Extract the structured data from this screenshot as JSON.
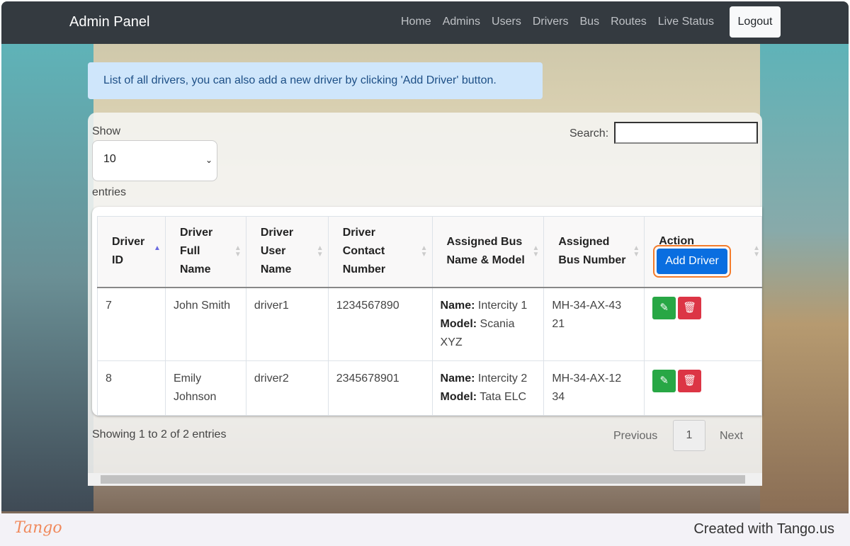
{
  "nav": {
    "brand": "Admin Panel",
    "links": [
      "Home",
      "Admins",
      "Users",
      "Drivers",
      "Bus",
      "Routes",
      "Live Status"
    ],
    "logout": "Logout"
  },
  "alert": "List of all drivers, you can also add a new driver by clicking 'Add Driver' button.",
  "controls": {
    "show": "Show",
    "entries_value": "10",
    "entries": "entries",
    "search_label": "Search:",
    "search_value": ""
  },
  "table": {
    "headers": [
      "Driver ID",
      "Driver Full Name",
      "Driver User Name",
      "Driver Contact Number",
      "Assigned Bus Name & Model",
      "Assigned Bus Number",
      "Action"
    ],
    "add_button": "Add Driver",
    "name_label": "Name:",
    "model_label": "Model:",
    "rows": [
      {
        "id": "7",
        "full_name": "John Smith",
        "username": "driver1",
        "contact": "1234567890",
        "bus_name": "Intercity 1",
        "bus_model": "Scania XYZ",
        "bus_number": "MH-34-AX-4321"
      },
      {
        "id": "8",
        "full_name": "Emily Johnson",
        "username": "driver2",
        "contact": "2345678901",
        "bus_name": "Intercity 2",
        "bus_model": "Tata ELC",
        "bus_number": "MH-34-AX-1234"
      }
    ]
  },
  "pagination": {
    "info": "Showing 1 to 2 of 2 entries",
    "previous": "Previous",
    "page": "1",
    "next": "Next"
  },
  "footer": {
    "logo": "Tango",
    "credit": "Created with Tango.us"
  },
  "colors": {
    "navbar": "#343a40",
    "primary": "#0a6ee0",
    "edit": "#28a745",
    "delete": "#dc3545",
    "highlight": "#f47b2a"
  }
}
